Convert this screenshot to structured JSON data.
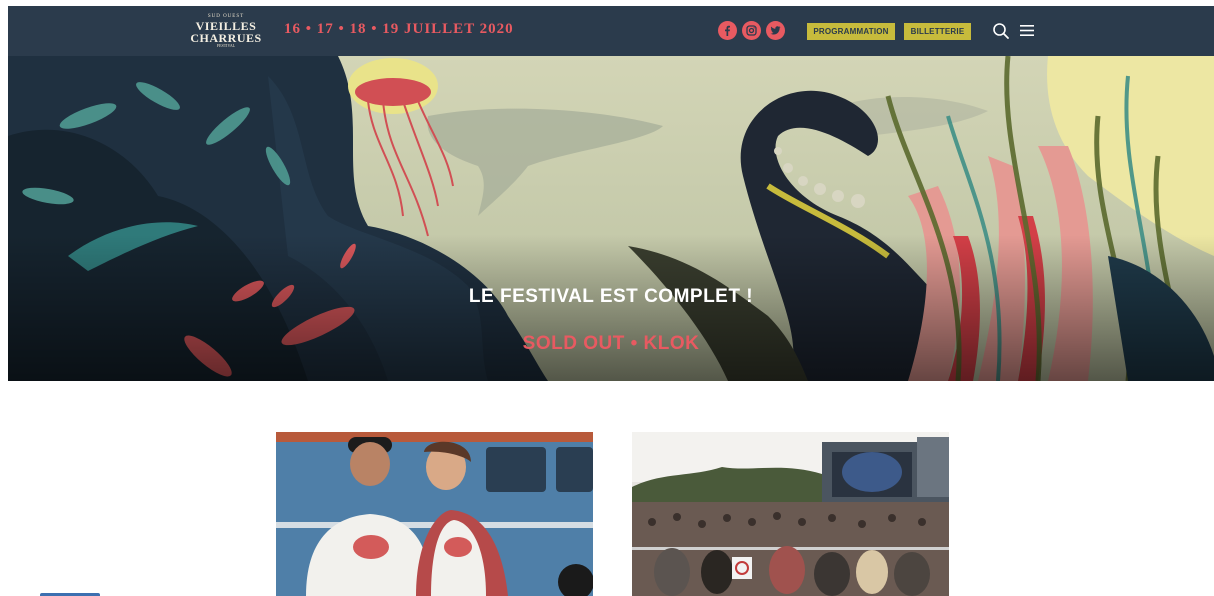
{
  "header": {
    "logo": {
      "small_line": "SUD OUEST",
      "line1": "VIEILLES",
      "line2": "CHARRUES",
      "tiny_line": "FESTIVAL"
    },
    "dates": "16 • 17 • 18 • 19  JUILLET 2020",
    "social": [
      "facebook-icon",
      "instagram-icon",
      "twitter-icon"
    ],
    "nav": {
      "programmation": "PROGRAMMATION",
      "billetterie": "BILLETTERIE"
    }
  },
  "hero": {
    "title": "LE FESTIVAL EST COMPLET !",
    "subtitle": "SOLD OUT • KLOK"
  },
  "colors": {
    "header_bg": "#2b3b4c",
    "accent_red": "#e85a61",
    "accent_yellow": "#c7bb3c"
  }
}
